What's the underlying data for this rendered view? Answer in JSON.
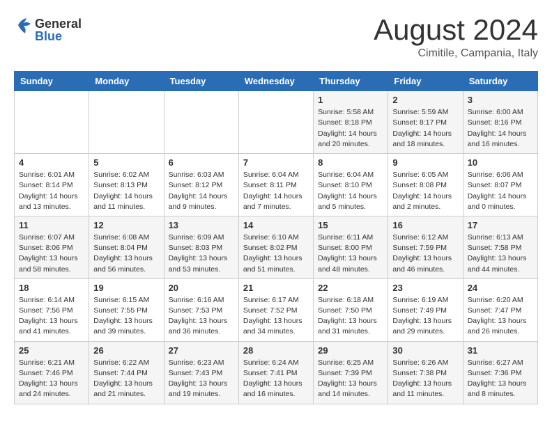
{
  "header": {
    "logo_general": "General",
    "logo_blue": "Blue",
    "main_title": "August 2024",
    "sub_title": "Cimitile, Campania, Italy"
  },
  "weekdays": [
    "Sunday",
    "Monday",
    "Tuesday",
    "Wednesday",
    "Thursday",
    "Friday",
    "Saturday"
  ],
  "weeks": [
    [
      {
        "day": "",
        "info": ""
      },
      {
        "day": "",
        "info": ""
      },
      {
        "day": "",
        "info": ""
      },
      {
        "day": "",
        "info": ""
      },
      {
        "day": "1",
        "info": "Sunrise: 5:58 AM\nSunset: 8:18 PM\nDaylight: 14 hours\nand 20 minutes."
      },
      {
        "day": "2",
        "info": "Sunrise: 5:59 AM\nSunset: 8:17 PM\nDaylight: 14 hours\nand 18 minutes."
      },
      {
        "day": "3",
        "info": "Sunrise: 6:00 AM\nSunset: 8:16 PM\nDaylight: 14 hours\nand 16 minutes."
      }
    ],
    [
      {
        "day": "4",
        "info": "Sunrise: 6:01 AM\nSunset: 8:14 PM\nDaylight: 14 hours\nand 13 minutes."
      },
      {
        "day": "5",
        "info": "Sunrise: 6:02 AM\nSunset: 8:13 PM\nDaylight: 14 hours\nand 11 minutes."
      },
      {
        "day": "6",
        "info": "Sunrise: 6:03 AM\nSunset: 8:12 PM\nDaylight: 14 hours\nand 9 minutes."
      },
      {
        "day": "7",
        "info": "Sunrise: 6:04 AM\nSunset: 8:11 PM\nDaylight: 14 hours\nand 7 minutes."
      },
      {
        "day": "8",
        "info": "Sunrise: 6:04 AM\nSunset: 8:10 PM\nDaylight: 14 hours\nand 5 minutes."
      },
      {
        "day": "9",
        "info": "Sunrise: 6:05 AM\nSunset: 8:08 PM\nDaylight: 14 hours\nand 2 minutes."
      },
      {
        "day": "10",
        "info": "Sunrise: 6:06 AM\nSunset: 8:07 PM\nDaylight: 14 hours\nand 0 minutes."
      }
    ],
    [
      {
        "day": "11",
        "info": "Sunrise: 6:07 AM\nSunset: 8:06 PM\nDaylight: 13 hours\nand 58 minutes."
      },
      {
        "day": "12",
        "info": "Sunrise: 6:08 AM\nSunset: 8:04 PM\nDaylight: 13 hours\nand 56 minutes."
      },
      {
        "day": "13",
        "info": "Sunrise: 6:09 AM\nSunset: 8:03 PM\nDaylight: 13 hours\nand 53 minutes."
      },
      {
        "day": "14",
        "info": "Sunrise: 6:10 AM\nSunset: 8:02 PM\nDaylight: 13 hours\nand 51 minutes."
      },
      {
        "day": "15",
        "info": "Sunrise: 6:11 AM\nSunset: 8:00 PM\nDaylight: 13 hours\nand 48 minutes."
      },
      {
        "day": "16",
        "info": "Sunrise: 6:12 AM\nSunset: 7:59 PM\nDaylight: 13 hours\nand 46 minutes."
      },
      {
        "day": "17",
        "info": "Sunrise: 6:13 AM\nSunset: 7:58 PM\nDaylight: 13 hours\nand 44 minutes."
      }
    ],
    [
      {
        "day": "18",
        "info": "Sunrise: 6:14 AM\nSunset: 7:56 PM\nDaylight: 13 hours\nand 41 minutes."
      },
      {
        "day": "19",
        "info": "Sunrise: 6:15 AM\nSunset: 7:55 PM\nDaylight: 13 hours\nand 39 minutes."
      },
      {
        "day": "20",
        "info": "Sunrise: 6:16 AM\nSunset: 7:53 PM\nDaylight: 13 hours\nand 36 minutes."
      },
      {
        "day": "21",
        "info": "Sunrise: 6:17 AM\nSunset: 7:52 PM\nDaylight: 13 hours\nand 34 minutes."
      },
      {
        "day": "22",
        "info": "Sunrise: 6:18 AM\nSunset: 7:50 PM\nDaylight: 13 hours\nand 31 minutes."
      },
      {
        "day": "23",
        "info": "Sunrise: 6:19 AM\nSunset: 7:49 PM\nDaylight: 13 hours\nand 29 minutes."
      },
      {
        "day": "24",
        "info": "Sunrise: 6:20 AM\nSunset: 7:47 PM\nDaylight: 13 hours\nand 26 minutes."
      }
    ],
    [
      {
        "day": "25",
        "info": "Sunrise: 6:21 AM\nSunset: 7:46 PM\nDaylight: 13 hours\nand 24 minutes."
      },
      {
        "day": "26",
        "info": "Sunrise: 6:22 AM\nSunset: 7:44 PM\nDaylight: 13 hours\nand 21 minutes."
      },
      {
        "day": "27",
        "info": "Sunrise: 6:23 AM\nSunset: 7:43 PM\nDaylight: 13 hours\nand 19 minutes."
      },
      {
        "day": "28",
        "info": "Sunrise: 6:24 AM\nSunset: 7:41 PM\nDaylight: 13 hours\nand 16 minutes."
      },
      {
        "day": "29",
        "info": "Sunrise: 6:25 AM\nSunset: 7:39 PM\nDaylight: 13 hours\nand 14 minutes."
      },
      {
        "day": "30",
        "info": "Sunrise: 6:26 AM\nSunset: 7:38 PM\nDaylight: 13 hours\nand 11 minutes."
      },
      {
        "day": "31",
        "info": "Sunrise: 6:27 AM\nSunset: 7:36 PM\nDaylight: 13 hours\nand 8 minutes."
      }
    ]
  ]
}
